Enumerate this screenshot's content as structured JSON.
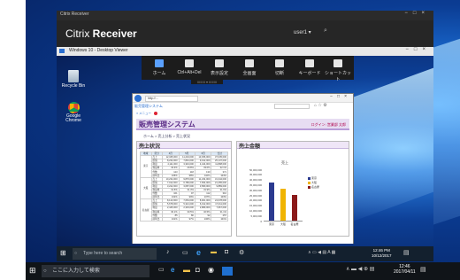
{
  "host": {
    "citrix_window_title": "Citrix Receiver",
    "citrix_logo_prefix": "Citrix",
    "citrix_logo_name": "Receiver",
    "user_menu": "user1",
    "taskbar_search_placeholder": "ここに入力して検索",
    "clock_time": "12:46",
    "clock_date": "2017/04/11"
  },
  "viewer": {
    "title": "Windows 10 - Desktop Viewer",
    "toolbar": [
      {
        "label": "ホーム",
        "icon": "home-icon"
      },
      {
        "label": "Ctrl+Alt+Del",
        "icon": "keyboard-icon"
      },
      {
        "label": "表示設定",
        "icon": "display-icon"
      },
      {
        "label": "全画面",
        "icon": "fullscreen-icon"
      },
      {
        "label": "切断",
        "icon": "disconnect-icon"
      },
      {
        "label": "キーボード",
        "icon": "keyboard-icon"
      },
      {
        "label": "ショートカット",
        "icon": "grid-icon"
      }
    ],
    "handle_label": "IIIIIIII ▾ IIIIIIII",
    "desktop_icons": [
      {
        "label": "Recycle Bin"
      },
      {
        "label": "Google Chrome"
      }
    ],
    "taskbar_search_placeholder": "Type here to search",
    "clock_time": "12:46 PM",
    "clock_date": "10/12/2017"
  },
  "browser": {
    "tab_title": "販売管理システム",
    "address": "http://...",
    "app_title": "販売管理システム",
    "app_subtitle": "ログイン: 営業部 太郎",
    "breadcrumbs": "ホーム > 売上分析 > 売上状況"
  },
  "sales_panel": {
    "title": "売上状況",
    "controls": "▼ ✓ —",
    "columns": [
      "地域",
      "区分",
      "4月",
      "5月",
      "6月",
      "合計"
    ],
    "groups": [
      {
        "name": "東京",
        "rows": [
          [
            "売上",
            "12,345,000",
            "11,234,000",
            "13,456,000",
            "37,035,000"
          ],
          [
            "原価",
            "8,234,000",
            "7,891,000",
            "9,012,000",
            "25,137,000"
          ],
          [
            "利益",
            "4,111,000",
            "3,343,000",
            "4,444,000",
            "11,898,000"
          ],
          [
            "利益率",
            "33.3%",
            "29.8%",
            "33.0%",
            "32.1%"
          ],
          [
            "件数",
            "123",
            "118",
            "130",
            "371"
          ],
          [
            "前年比",
            "105%",
            "98%",
            "110%",
            "104%"
          ]
        ]
      },
      {
        "name": "大阪",
        "rows": [
          [
            "売上",
            "10,234,000",
            "9,876,000",
            "11,234,000",
            "31,344,000"
          ],
          [
            "原価",
            "7,012,000",
            "6,789,000",
            "7,654,000",
            "21,455,000"
          ],
          [
            "利益",
            "3,222,000",
            "3,087,000",
            "3,580,000",
            "9,889,000"
          ],
          [
            "利益率",
            "31.5%",
            "31.3%",
            "31.9%",
            "31.6%"
          ],
          [
            "件数",
            "101",
            "97",
            "112",
            "310"
          ],
          [
            "前年比",
            "102%",
            "99%",
            "107%",
            "103%"
          ]
        ]
      },
      {
        "name": "名古屋",
        "rows": [
          [
            "売上",
            "8,123,000",
            "7,654,000",
            "8,901,000",
            "24,678,000"
          ],
          [
            "原価",
            "5,678,000",
            "5,321,000",
            "6,012,000",
            "17,011,000"
          ],
          [
            "利益",
            "2,445,000",
            "2,333,000",
            "2,889,000",
            "7,667,000"
          ],
          [
            "利益率",
            "30.1%",
            "30.5%",
            "32.5%",
            "31.1%"
          ],
          [
            "件数",
            "85",
            "80",
            "92",
            "257"
          ],
          [
            "前年比",
            "101%",
            "97%",
            "106%",
            "101%"
          ]
        ]
      }
    ]
  },
  "chart_panel": {
    "title": "売上金額",
    "controls": "▼ ✓ —"
  },
  "chart_data": {
    "type": "bar",
    "title": "売上",
    "categories": [
      "東京",
      "大阪",
      "名古屋"
    ],
    "values": [
      37000000,
      31000000,
      25000000
    ],
    "colors": [
      "#2b3a8f",
      "#f0b400",
      "#8b1a1a"
    ],
    "legend": [
      "東京",
      "大阪",
      "名古屋"
    ],
    "ylim": [
      0,
      50000000
    ],
    "yticks": [
      "50,000,000",
      "45,000,000",
      "40,000,000",
      "35,000,000",
      "30,000,000",
      "25,000,000",
      "20,000,000",
      "15,000,000",
      "10,000,000",
      "5,000,000",
      "0"
    ]
  }
}
